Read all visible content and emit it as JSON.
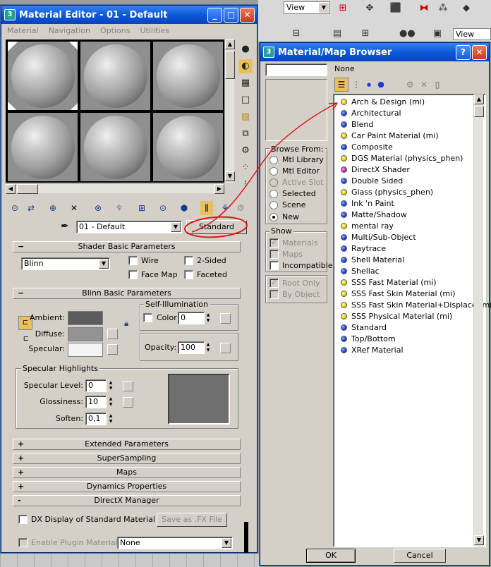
{
  "background": {
    "view_select_1": "View",
    "view_select_2": "View"
  },
  "material_editor": {
    "title": "Material Editor - 01 - Default",
    "menu": [
      "Material",
      "Navigation",
      "Options",
      "Utilities"
    ],
    "material_name": "01 - Default",
    "type_button": "Standard",
    "shader_rollout": {
      "title": "Shader Basic Parameters",
      "shader": "Blinn",
      "wire": "Wire",
      "two_sided": "2-Sided",
      "face_map": "Face Map",
      "faceted": "Faceted"
    },
    "blinn_rollout": {
      "title": "Blinn Basic Parameters",
      "ambient": "Ambient:",
      "diffuse": "Diffuse:",
      "specular": "Specular:",
      "self_illum_title": "Self-Illumination",
      "color_label": "Color",
      "color_value": "0",
      "opacity_label": "Opacity:",
      "opacity_value": "100",
      "spec_highlights_title": "Specular Highlights",
      "spec_level_label": "Specular Level:",
      "spec_level_value": "0",
      "glossiness_label": "Glossiness:",
      "glossiness_value": "10",
      "soften_label": "Soften:",
      "soften_value": "0,1"
    },
    "rollouts": [
      {
        "sign": "+",
        "title": "Extended Parameters"
      },
      {
        "sign": "+",
        "title": "SuperSampling"
      },
      {
        "sign": "+",
        "title": "Maps"
      },
      {
        "sign": "+",
        "title": "Dynamics Properties"
      },
      {
        "sign": "-",
        "title": "DirectX Manager"
      }
    ],
    "directx": {
      "dx_display": "DX Display of Standard Material",
      "save_fx": "Save as .FX File",
      "enable_plugin": "Enable Plugin Material",
      "plugin_value": "None"
    }
  },
  "browser": {
    "title": "Material/Map Browser",
    "name_field": "",
    "selected_name": "None",
    "browse_from_title": "Browse From:",
    "browse_from": [
      "Mtl Library",
      "Mtl Editor",
      "Active Slot",
      "Selected",
      "Scene",
      "New"
    ],
    "browse_selected": "New",
    "show_title": "Show",
    "show": [
      "Materials",
      "Maps",
      "Incompatible"
    ],
    "root_only": "Root Only",
    "by_object": "By Object",
    "materials": [
      {
        "name": "Arch & Design (mi)",
        "color": "yellow"
      },
      {
        "name": "Architectural",
        "color": "blue"
      },
      {
        "name": "Blend",
        "color": "blue"
      },
      {
        "name": "Car Paint Material (mi)",
        "color": "yellow"
      },
      {
        "name": "Composite",
        "color": "blue"
      },
      {
        "name": "DGS Material (physics_phen)",
        "color": "yellow"
      },
      {
        "name": "DirectX Shader",
        "color": "magenta"
      },
      {
        "name": "Double Sided",
        "color": "blue"
      },
      {
        "name": "Glass (physics_phen)",
        "color": "yellow"
      },
      {
        "name": "Ink 'n Paint",
        "color": "blue"
      },
      {
        "name": "Matte/Shadow",
        "color": "blue"
      },
      {
        "name": "mental ray",
        "color": "yellow"
      },
      {
        "name": "Multi/Sub-Object",
        "color": "blue"
      },
      {
        "name": "Raytrace",
        "color": "blue"
      },
      {
        "name": "Shell Material",
        "color": "blue"
      },
      {
        "name": "Shellac",
        "color": "blue"
      },
      {
        "name": "SSS Fast Material (mi)",
        "color": "yellow"
      },
      {
        "name": "SSS Fast Skin Material (mi)",
        "color": "yellow"
      },
      {
        "name": "SSS Fast Skin Material+Displace (mi",
        "color": "yellow"
      },
      {
        "name": "SSS Physical Material (mi)",
        "color": "yellow"
      },
      {
        "name": "Standard",
        "color": "blue"
      },
      {
        "name": "Top/Bottom",
        "color": "blue"
      },
      {
        "name": "XRef Material",
        "color": "blue"
      }
    ],
    "ok": "OK",
    "cancel": "Cancel"
  },
  "colors": {
    "title_blue": "#0a5ad8",
    "panel_gray": "#d4d0c8",
    "annotation_red": "#d81818"
  }
}
